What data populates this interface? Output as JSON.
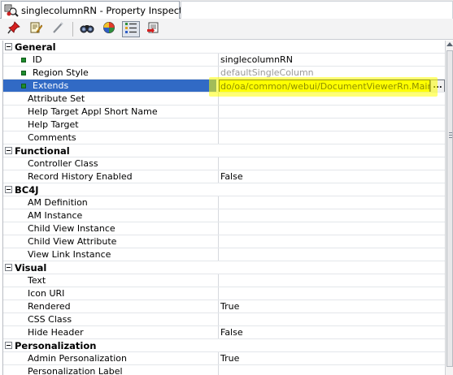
{
  "window": {
    "tab_title": "singlecolumnRN - Property Inspector",
    "tab_icon": "property-inspector-icon"
  },
  "toolbar": {
    "buttons": [
      {
        "name": "pin-icon",
        "pressed": false
      },
      {
        "name": "edit-properties-icon",
        "pressed": false
      },
      {
        "name": "wand-icon",
        "pressed": false
      },
      {
        "name": "find-icon",
        "pressed": false
      },
      {
        "name": "color-palette-icon",
        "pressed": false
      },
      {
        "name": "categorized-view-icon",
        "pressed": true
      },
      {
        "name": "export-icon",
        "pressed": false
      }
    ]
  },
  "categories": [
    {
      "label": "General",
      "properties": [
        {
          "name": "ID",
          "value": "singlecolumnRN",
          "bullet": true
        },
        {
          "name": "Region Style",
          "value": "defaultSingleColumn",
          "bullet": true,
          "disabled": true
        },
        {
          "name": "Extends",
          "value": "/oracle/apps/fnd/framework/webui/DocumentViewerRn.MainRegion",
          "bullet": true,
          "selected": true,
          "visible_value": "do/oa/common/webui/DocumentViewerRn.MainRegion"
        },
        {
          "name": "Attribute Set",
          "value": ""
        },
        {
          "name": "Help Target Appl Short Name",
          "value": ""
        },
        {
          "name": "Help Target",
          "value": ""
        },
        {
          "name": "Comments",
          "value": ""
        }
      ]
    },
    {
      "label": "Functional",
      "properties": [
        {
          "name": "Controller Class",
          "value": ""
        },
        {
          "name": "Record History Enabled",
          "value": "False"
        }
      ]
    },
    {
      "label": "BC4J",
      "properties": [
        {
          "name": "AM Definition",
          "value": ""
        },
        {
          "name": "AM Instance",
          "value": ""
        },
        {
          "name": "Child View Instance",
          "value": ""
        },
        {
          "name": "Child View Attribute",
          "value": ""
        },
        {
          "name": "View Link Instance",
          "value": ""
        }
      ]
    },
    {
      "label": "Visual",
      "properties": [
        {
          "name": "Text",
          "value": ""
        },
        {
          "name": "Icon URI",
          "value": ""
        },
        {
          "name": "Rendered",
          "value": "True"
        },
        {
          "name": "CSS Class",
          "value": ""
        },
        {
          "name": "Hide Header",
          "value": "False"
        }
      ]
    },
    {
      "label": "Personalization",
      "properties": [
        {
          "name": "Admin Personalization",
          "value": "True"
        },
        {
          "name": "Personalization Label",
          "value": ""
        }
      ]
    }
  ],
  "extends_button_label": "...",
  "colors": {
    "selection": "#316ac5",
    "highlight": "#ffff00",
    "bullet": "#1e8c2d"
  }
}
